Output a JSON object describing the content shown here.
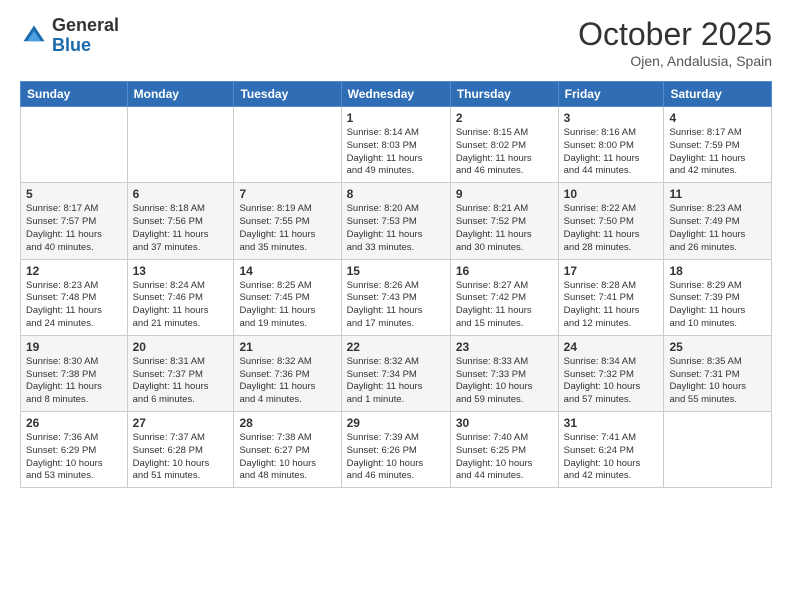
{
  "header": {
    "logo_general": "General",
    "logo_blue": "Blue",
    "title": "October 2025",
    "location": "Ojen, Andalusia, Spain"
  },
  "weekdays": [
    "Sunday",
    "Monday",
    "Tuesday",
    "Wednesday",
    "Thursday",
    "Friday",
    "Saturday"
  ],
  "weeks": [
    [
      {
        "num": "",
        "info": ""
      },
      {
        "num": "",
        "info": ""
      },
      {
        "num": "",
        "info": ""
      },
      {
        "num": "1",
        "info": "Sunrise: 8:14 AM\nSunset: 8:03 PM\nDaylight: 11 hours\nand 49 minutes."
      },
      {
        "num": "2",
        "info": "Sunrise: 8:15 AM\nSunset: 8:02 PM\nDaylight: 11 hours\nand 46 minutes."
      },
      {
        "num": "3",
        "info": "Sunrise: 8:16 AM\nSunset: 8:00 PM\nDaylight: 11 hours\nand 44 minutes."
      },
      {
        "num": "4",
        "info": "Sunrise: 8:17 AM\nSunset: 7:59 PM\nDaylight: 11 hours\nand 42 minutes."
      }
    ],
    [
      {
        "num": "5",
        "info": "Sunrise: 8:17 AM\nSunset: 7:57 PM\nDaylight: 11 hours\nand 40 minutes."
      },
      {
        "num": "6",
        "info": "Sunrise: 8:18 AM\nSunset: 7:56 PM\nDaylight: 11 hours\nand 37 minutes."
      },
      {
        "num": "7",
        "info": "Sunrise: 8:19 AM\nSunset: 7:55 PM\nDaylight: 11 hours\nand 35 minutes."
      },
      {
        "num": "8",
        "info": "Sunrise: 8:20 AM\nSunset: 7:53 PM\nDaylight: 11 hours\nand 33 minutes."
      },
      {
        "num": "9",
        "info": "Sunrise: 8:21 AM\nSunset: 7:52 PM\nDaylight: 11 hours\nand 30 minutes."
      },
      {
        "num": "10",
        "info": "Sunrise: 8:22 AM\nSunset: 7:50 PM\nDaylight: 11 hours\nand 28 minutes."
      },
      {
        "num": "11",
        "info": "Sunrise: 8:23 AM\nSunset: 7:49 PM\nDaylight: 11 hours\nand 26 minutes."
      }
    ],
    [
      {
        "num": "12",
        "info": "Sunrise: 8:23 AM\nSunset: 7:48 PM\nDaylight: 11 hours\nand 24 minutes."
      },
      {
        "num": "13",
        "info": "Sunrise: 8:24 AM\nSunset: 7:46 PM\nDaylight: 11 hours\nand 21 minutes."
      },
      {
        "num": "14",
        "info": "Sunrise: 8:25 AM\nSunset: 7:45 PM\nDaylight: 11 hours\nand 19 minutes."
      },
      {
        "num": "15",
        "info": "Sunrise: 8:26 AM\nSunset: 7:43 PM\nDaylight: 11 hours\nand 17 minutes."
      },
      {
        "num": "16",
        "info": "Sunrise: 8:27 AM\nSunset: 7:42 PM\nDaylight: 11 hours\nand 15 minutes."
      },
      {
        "num": "17",
        "info": "Sunrise: 8:28 AM\nSunset: 7:41 PM\nDaylight: 11 hours\nand 12 minutes."
      },
      {
        "num": "18",
        "info": "Sunrise: 8:29 AM\nSunset: 7:39 PM\nDaylight: 11 hours\nand 10 minutes."
      }
    ],
    [
      {
        "num": "19",
        "info": "Sunrise: 8:30 AM\nSunset: 7:38 PM\nDaylight: 11 hours\nand 8 minutes."
      },
      {
        "num": "20",
        "info": "Sunrise: 8:31 AM\nSunset: 7:37 PM\nDaylight: 11 hours\nand 6 minutes."
      },
      {
        "num": "21",
        "info": "Sunrise: 8:32 AM\nSunset: 7:36 PM\nDaylight: 11 hours\nand 4 minutes."
      },
      {
        "num": "22",
        "info": "Sunrise: 8:32 AM\nSunset: 7:34 PM\nDaylight: 11 hours\nand 1 minute."
      },
      {
        "num": "23",
        "info": "Sunrise: 8:33 AM\nSunset: 7:33 PM\nDaylight: 10 hours\nand 59 minutes."
      },
      {
        "num": "24",
        "info": "Sunrise: 8:34 AM\nSunset: 7:32 PM\nDaylight: 10 hours\nand 57 minutes."
      },
      {
        "num": "25",
        "info": "Sunrise: 8:35 AM\nSunset: 7:31 PM\nDaylight: 10 hours\nand 55 minutes."
      }
    ],
    [
      {
        "num": "26",
        "info": "Sunrise: 7:36 AM\nSunset: 6:29 PM\nDaylight: 10 hours\nand 53 minutes."
      },
      {
        "num": "27",
        "info": "Sunrise: 7:37 AM\nSunset: 6:28 PM\nDaylight: 10 hours\nand 51 minutes."
      },
      {
        "num": "28",
        "info": "Sunrise: 7:38 AM\nSunset: 6:27 PM\nDaylight: 10 hours\nand 48 minutes."
      },
      {
        "num": "29",
        "info": "Sunrise: 7:39 AM\nSunset: 6:26 PM\nDaylight: 10 hours\nand 46 minutes."
      },
      {
        "num": "30",
        "info": "Sunrise: 7:40 AM\nSunset: 6:25 PM\nDaylight: 10 hours\nand 44 minutes."
      },
      {
        "num": "31",
        "info": "Sunrise: 7:41 AM\nSunset: 6:24 PM\nDaylight: 10 hours\nand 42 minutes."
      },
      {
        "num": "",
        "info": ""
      }
    ]
  ]
}
